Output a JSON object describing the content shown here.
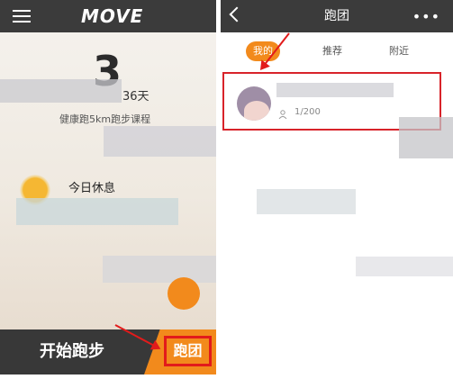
{
  "left_screen": {
    "logo": "MOVE",
    "day_count": "3",
    "days_suffix": "36天",
    "course": "健康跑5km跑步课程",
    "rest_label": "今日休息",
    "start_button": "开始跑步",
    "run_team_button": "跑团"
  },
  "right_screen": {
    "title": "跑团",
    "tabs": [
      "我的",
      "推荐",
      "附近"
    ],
    "active_tab": "我的",
    "team_card": {
      "member_count": "1/200"
    }
  },
  "colors": {
    "accent": "#f28a1c",
    "highlight": "#e21b1b",
    "topbar": "#3b3b3b"
  }
}
